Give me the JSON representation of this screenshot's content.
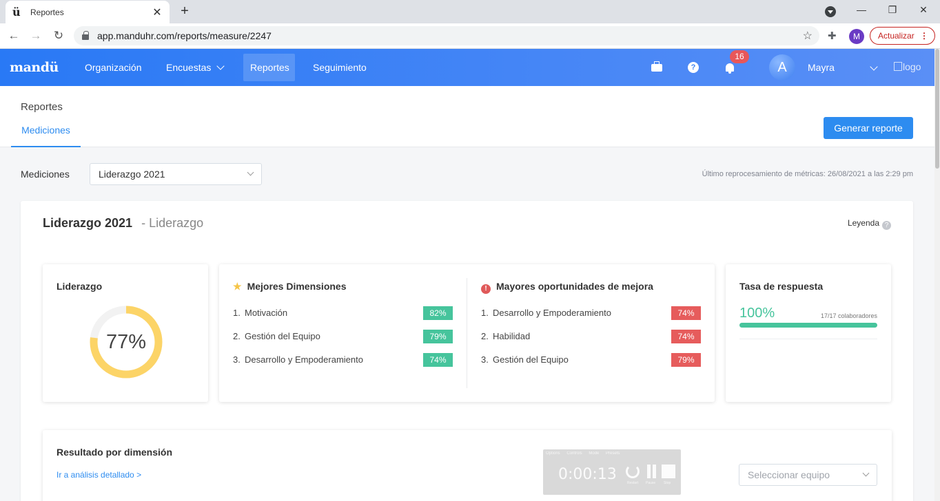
{
  "browser": {
    "tab_title": "Reportes",
    "tab_favicon": "ü",
    "close": "✕",
    "newtab": "+",
    "url": "app.manduhr.com/reports/measure/2247",
    "profile_initial": "M",
    "update_label": "Actualizar",
    "update_menu": "⋮",
    "win": {
      "minimize": "—",
      "restore": "❐",
      "close": "✕"
    },
    "nav": {
      "back": "←",
      "forward": "→",
      "reload": "↻"
    },
    "star": "☆",
    "extensions": "✚"
  },
  "app": {
    "brand": "mandü",
    "nav": [
      {
        "label": "Organización"
      },
      {
        "label": "Encuestas"
      },
      {
        "label": "Reportes"
      },
      {
        "label": "Seguimiento"
      }
    ],
    "help": "?",
    "notifications": "16",
    "user_initial": "A",
    "user_name": "Mayra",
    "logo_alt": "logo"
  },
  "page": {
    "breadcrumb": "Reportes",
    "tab_label": "Mediciones",
    "generate_button": "Generar reporte",
    "filter_label": "Mediciones",
    "filter_value": "Liderazgo 2021",
    "reprocess_text": "Último reprocesamiento de métricas: 26/08/2021 a las 2:29 pm"
  },
  "panel": {
    "title": "Liderazgo 2021",
    "subtitle": "- Liderazgo",
    "legend": "Leyenda",
    "legend_icon": "?",
    "score_card": {
      "title": "Liderazgo",
      "value_label": "77%",
      "value": 0.77,
      "color": "#fcd467",
      "track": "#f2f2f2"
    },
    "best": {
      "title": "Mejores Dimensiones",
      "icon": "★",
      "items": [
        {
          "rank": "1.",
          "name": "Motivación",
          "pct": "82%"
        },
        {
          "rank": "2.",
          "name": "Gestión del Equipo",
          "pct": "79%"
        },
        {
          "rank": "3.",
          "name": "Desarrollo y Empoderamiento",
          "pct": "74%"
        }
      ]
    },
    "worst": {
      "title": "Mayores oportunidades de mejora",
      "icon": "!",
      "items": [
        {
          "rank": "1.",
          "name": "Desarrollo y Empoderamiento",
          "pct": "74%"
        },
        {
          "rank": "2.",
          "name": "Habilidad",
          "pct": "74%"
        },
        {
          "rank": "3.",
          "name": "Gestión del Equipo",
          "pct": "79%"
        }
      ]
    },
    "response": {
      "title": "Tasa de respuesta",
      "value_label": "100%",
      "value": 1.0,
      "meta": "17/17 colaboradores"
    },
    "dimension": {
      "title": "Resultado por dimensión",
      "link": "Ir a análisis detallado >",
      "team_placeholder": "Seleccionar equipo"
    },
    "timer": {
      "menu": "Options Controls Mode Presets",
      "time": "0:00:13",
      "labels": [
        "Restart",
        "Pause",
        "Stop"
      ]
    }
  }
}
